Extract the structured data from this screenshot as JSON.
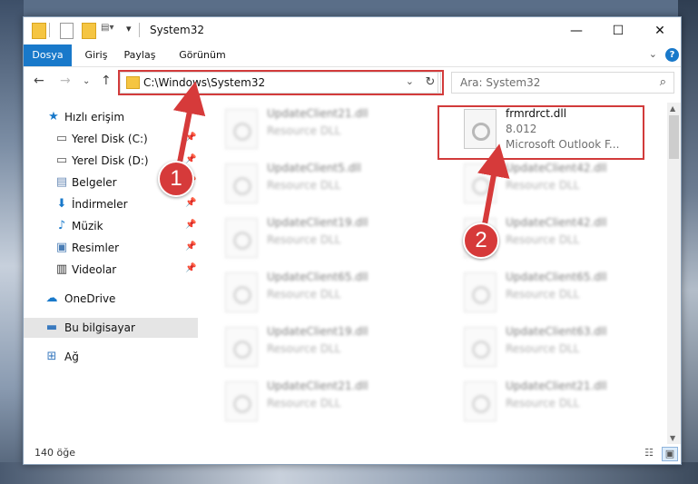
{
  "window": {
    "title": "System32"
  },
  "ribbon": {
    "tabs": [
      "Dosya",
      "Giriş",
      "Paylaş",
      "Görünüm"
    ]
  },
  "address": {
    "path": "C:\\Windows\\System32"
  },
  "search": {
    "placeholder": "Ara: System32"
  },
  "sidebar": {
    "items": [
      {
        "label": "Hızlı erişim",
        "icon": "star-icon",
        "pinned": false
      },
      {
        "label": "Yerel Disk (C:)",
        "icon": "drive-icon",
        "pinned": true
      },
      {
        "label": "Yerel Disk (D:)",
        "icon": "drive-icon",
        "pinned": true
      },
      {
        "label": "Belgeler",
        "icon": "documents-icon",
        "pinned": true
      },
      {
        "label": "İndirmeler",
        "icon": "download-icon",
        "pinned": true
      },
      {
        "label": "Müzik",
        "icon": "music-icon",
        "pinned": true
      },
      {
        "label": "Resimler",
        "icon": "pictures-icon",
        "pinned": true
      },
      {
        "label": "Videolar",
        "icon": "video-icon",
        "pinned": true
      },
      {
        "label": "OneDrive",
        "icon": "cloud-icon",
        "pinned": false
      },
      {
        "label": "Bu bilgisayar",
        "icon": "computer-icon",
        "pinned": false
      },
      {
        "label": "Ağ",
        "icon": "network-icon",
        "pinned": false
      }
    ]
  },
  "files": {
    "highlight": {
      "name": "frmrdrct.dll",
      "version": "8.012",
      "desc": "Microsoft Outlook F..."
    },
    "left_col": [
      {
        "name": "UpdateClient21.dll",
        "type": "Resource DLL"
      },
      {
        "name": "UpdateClient5.dll",
        "type": "Resource DLL"
      },
      {
        "name": "UpdateClient19.dll",
        "type": "Resource DLL"
      },
      {
        "name": "UpdateClient65.dll",
        "type": "Resource DLL"
      },
      {
        "name": "UpdateClient19.dll",
        "type": "Resource DLL"
      },
      {
        "name": "UpdateClient21.dll",
        "type": "Resource DLL"
      }
    ],
    "right_col": [
      {
        "name": "UpdateClient42.dll",
        "type": "Resource DLL"
      },
      {
        "name": "UpdateClient42.dll",
        "type": "Resource DLL"
      },
      {
        "name": "UpdateClient65.dll",
        "type": "Resource DLL"
      },
      {
        "name": "UpdateClient63.dll",
        "type": "Resource DLL"
      },
      {
        "name": "UpdateClient21.dll",
        "type": "Resource DLL"
      }
    ]
  },
  "status": {
    "count": "140 öğe"
  },
  "markers": [
    "1",
    "2"
  ],
  "colors": {
    "accent": "#1979ca",
    "highlight": "#d23b3b"
  }
}
